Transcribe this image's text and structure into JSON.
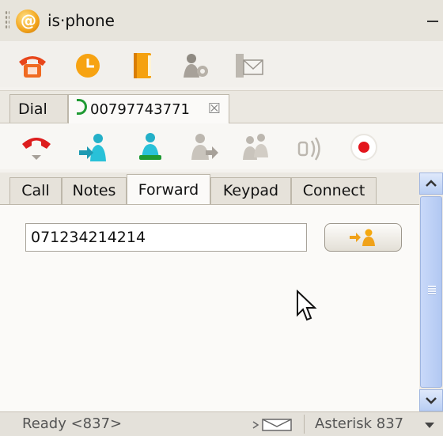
{
  "app": {
    "title": "is·phone"
  },
  "toolbar": {
    "icons": [
      "phone-icon",
      "clock-icon",
      "address-book-icon",
      "user-settings-icon",
      "fax-icon"
    ]
  },
  "tabs": [
    {
      "label": "Dial"
    },
    {
      "label": "00797743771",
      "close_icon": "close-icon"
    }
  ],
  "call_toolbar": {
    "icons": [
      "hangup-icon",
      "transfer-icon",
      "attended-transfer-icon",
      "conference-icon",
      "group-icon",
      "mute-icon",
      "record-icon"
    ]
  },
  "subtabs": [
    {
      "label": "Call"
    },
    {
      "label": "Notes"
    },
    {
      "label": "Forward",
      "active": true
    },
    {
      "label": "Keypad"
    },
    {
      "label": "Connect"
    }
  ],
  "forward": {
    "number": "071234214214"
  },
  "status": {
    "text": "Ready <837>",
    "server": "Asterisk 837"
  },
  "colors": {
    "accent_green": "#1f9a33",
    "record_red": "#e3151c",
    "scroll_blue": "#b8cdf3"
  }
}
